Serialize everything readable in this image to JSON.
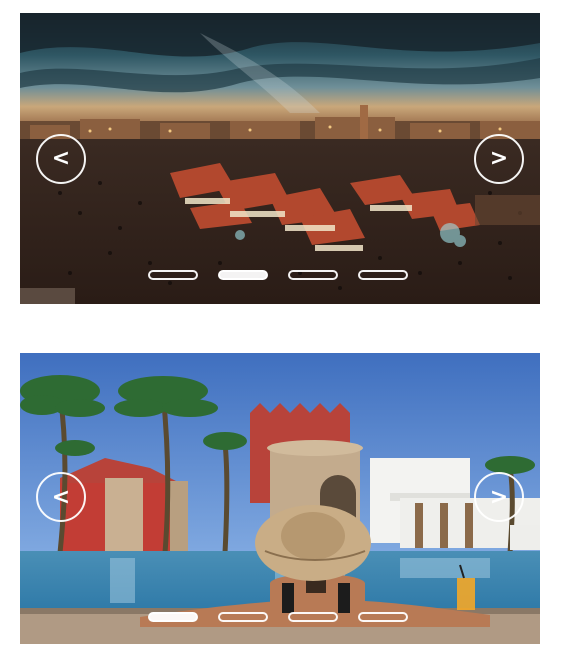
{
  "carousels": [
    {
      "scene": "night-market-square",
      "prev_label": "<",
      "next_label": ">",
      "slide_count": 4,
      "active_index": 1
    },
    {
      "scene": "poolside-resort",
      "prev_label": "<",
      "next_label": ">",
      "slide_count": 4,
      "active_index": 0
    }
  ],
  "colors": {
    "control_outline": "#ffffff",
    "page_background": "#ffffff"
  }
}
